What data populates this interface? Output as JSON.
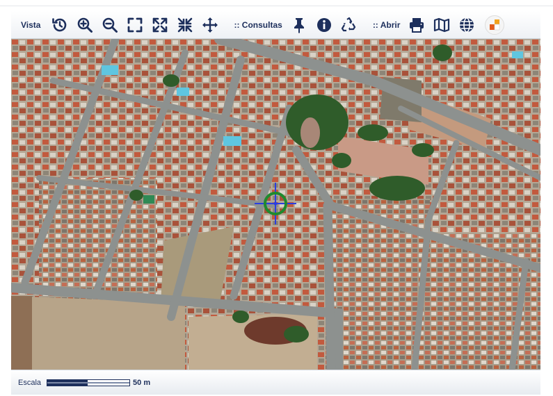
{
  "toolbar": {
    "view_label": "Vista",
    "queries_label": ":: Consultas",
    "open_label": ":: Abrir",
    "accent_color": "#1d2f5c",
    "buttons": [
      {
        "icon": "history-icon"
      },
      {
        "icon": "zoom-in-icon"
      },
      {
        "icon": "zoom-out-icon"
      },
      {
        "icon": "full-extent-icon"
      },
      {
        "icon": "expand-icon"
      },
      {
        "icon": "shrink-icon"
      },
      {
        "icon": "pan-icon"
      },
      {
        "icon": "pin-icon"
      },
      {
        "icon": "info-icon"
      },
      {
        "icon": "recycle-icon"
      },
      {
        "icon": "print-icon"
      },
      {
        "icon": "map-icon"
      },
      {
        "icon": "globe-icon"
      },
      {
        "icon": "app-logo-icon"
      }
    ]
  },
  "map": {
    "imagery": "aerial-photo",
    "marker_icon": "crosshair-target-icon",
    "marker_color": "#1f8a2e"
  },
  "scale": {
    "label": "Escala",
    "value": "50 m"
  }
}
